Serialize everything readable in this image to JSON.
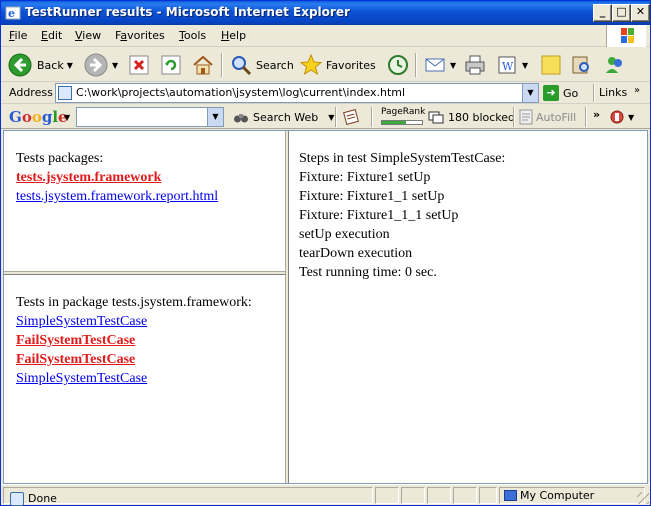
{
  "window": {
    "title": "TestRunner results - Microsoft Internet Explorer",
    "buttons": {
      "minimize": "_",
      "maximize": "□",
      "close": "✕"
    }
  },
  "menu": {
    "items": [
      {
        "label": "File",
        "accel": "F",
        "rest": "ile"
      },
      {
        "label": "Edit",
        "accel": "E",
        "rest": "dit"
      },
      {
        "label": "View",
        "accel": "V",
        "rest": "iew"
      },
      {
        "label": "Favorites",
        "accel": "a",
        "prefix": "F",
        "rest": "vorites"
      },
      {
        "label": "Tools",
        "accel": "T",
        "rest": "ools"
      },
      {
        "label": "Help",
        "accel": "H",
        "rest": "elp"
      }
    ]
  },
  "toolbar": {
    "back": "Back",
    "search": "Search",
    "favorites": "Favorites"
  },
  "address": {
    "label": "Address",
    "url": "C:\\work\\projects\\automation\\jsystem\\log\\current\\index.html",
    "go": "Go",
    "links": "Links"
  },
  "google": {
    "logo": [
      "G",
      "o",
      "o",
      "g",
      "l",
      "e"
    ],
    "search_value": "",
    "search_web": "Search Web",
    "pagerank": "PageRank",
    "pagerank_level": 0.6,
    "blocked": "180 blocked",
    "autofill": "AutoFill"
  },
  "frames": {
    "packages": {
      "heading": "Tests packages:",
      "links": [
        {
          "text": "tests.jsystem.framework",
          "status": "fail"
        },
        {
          "text": "tests.jsystem.framework.report.html",
          "status": "pass"
        }
      ]
    },
    "tests": {
      "heading": "Tests in package tests.jsystem.framework:",
      "links": [
        {
          "text": "SimpleSystemTestCase",
          "status": "pass"
        },
        {
          "text": "FailSystemTestCase",
          "status": "fail"
        },
        {
          "text": "FailSystemTestCase",
          "status": "fail"
        },
        {
          "text": "SimpleSystemTestCase",
          "status": "pass"
        }
      ]
    },
    "steps": {
      "lines": [
        "Steps in test SimpleSystemTestCase:",
        "Fixture: Fixture1 setUp",
        "Fixture: Fixture1_1 setUp",
        "Fixture: Fixture1_1_1 setUp",
        "setUp execution",
        "tearDown execution",
        "Test running time: 0 sec."
      ]
    }
  },
  "status": {
    "text": "Done",
    "zone": "My Computer"
  },
  "colors": {
    "fail_link": "#e01a1a",
    "pass_link": "#0000ee",
    "titlebar": "#0b52d4"
  }
}
